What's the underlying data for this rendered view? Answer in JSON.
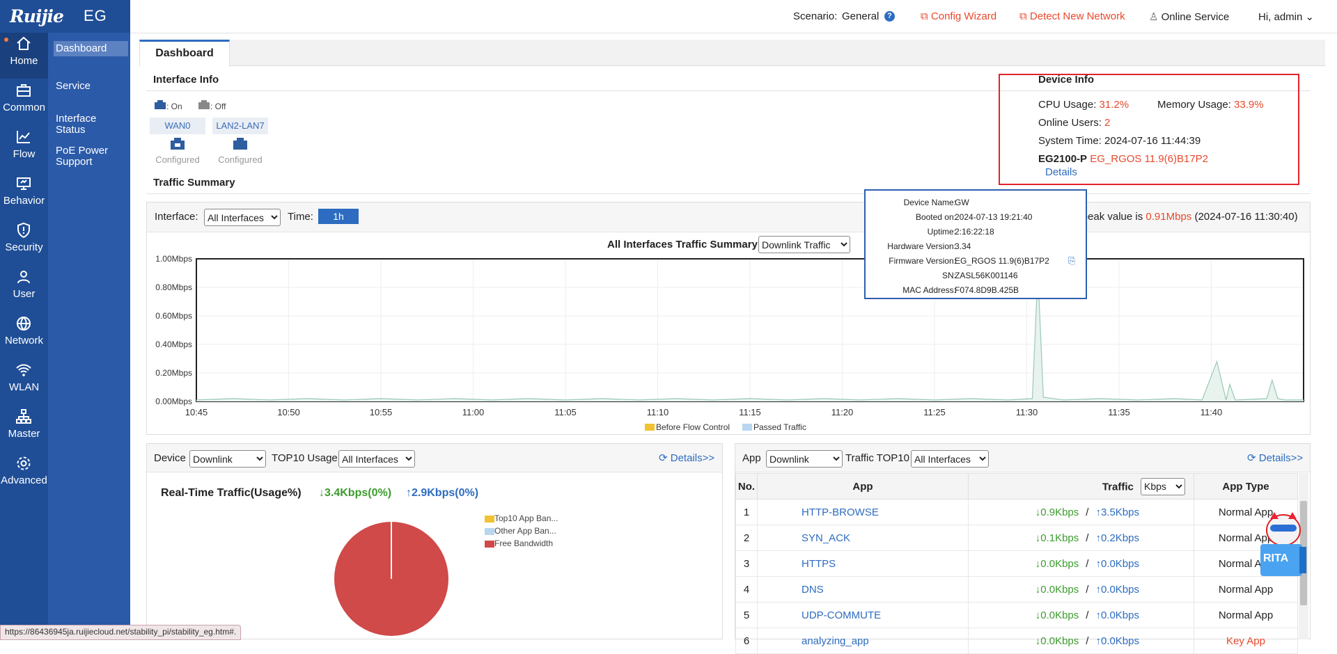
{
  "app": {
    "logo": "Ruijie",
    "product": "EG"
  },
  "rail": [
    {
      "label": "Home",
      "icon": "home-icon"
    },
    {
      "label": "Common",
      "icon": "briefcase-icon"
    },
    {
      "label": "Flow",
      "icon": "line-chart-icon"
    },
    {
      "label": "Behavior",
      "icon": "monitor-icon"
    },
    {
      "label": "Security",
      "icon": "shield-icon"
    },
    {
      "label": "User",
      "icon": "user-icon"
    },
    {
      "label": "Network",
      "icon": "globe-icon"
    },
    {
      "label": "WLAN",
      "icon": "wifi-icon"
    },
    {
      "label": "Master",
      "icon": "hierarchy-icon"
    },
    {
      "label": "Advanced",
      "icon": "gear-icon"
    }
  ],
  "subnav": [
    "Dashboard",
    "Service",
    "Interface Status",
    "PoE Power Support"
  ],
  "topbar": {
    "scenario_label": "Scenario:",
    "scenario_value": "General",
    "config_wizard": "Config Wizard",
    "detect_network": "Detect New Network",
    "online_service": "Online Service",
    "user": "Hi, admin"
  },
  "tab": "Dashboard",
  "interface_info": {
    "title": "Interface Info",
    "legend_on": ": On",
    "legend_off": ": Off",
    "ports": [
      {
        "name": "WAN0",
        "status": "Configured"
      },
      {
        "name": "LAN2-LAN7",
        "status": "Configured"
      }
    ]
  },
  "device_info": {
    "title": "Device Info",
    "cpu_label": "CPU Usage:",
    "cpu_value": "31.2%",
    "mem_label": "Memory Usage:",
    "mem_value": "33.9%",
    "users_label": "Online Users:",
    "users_value": "2",
    "time_label": "System Time:",
    "time_value": "2024-07-16 11:44:39",
    "model": "EG2100-P",
    "firmware": "EG_RGOS 11.9(6)B17P2",
    "details": "Details"
  },
  "popover": [
    {
      "k": "Device Name:",
      "v": "GW"
    },
    {
      "k": "Booted on:",
      "v": "2024-07-13 19:21:40"
    },
    {
      "k": "Uptime:",
      "v": "2:16:22:18"
    },
    {
      "k": "Hardware Version:",
      "v": "3.34"
    },
    {
      "k": "Firmware Version:",
      "v": "EG_RGOS 11.9(6)B17P2"
    },
    {
      "k": "SN:",
      "v": "ZASL56K001146"
    },
    {
      "k": "MAC Address:",
      "v": "F074.8D9B.425B"
    }
  ],
  "traffic_summary": {
    "title": "Traffic Summary",
    "interface_label": "Interface:",
    "interface_value": "All Interfaces",
    "time_label": "Time:",
    "time_value": "1h",
    "peak_prefix": "c peak value is",
    "peak_value": "0.91Mbps",
    "peak_time": "(2024-07-16 11:30:40)",
    "chart_title": "All Interfaces Traffic Summary",
    "chart_select": "Downlink Traffic"
  },
  "chart_data": {
    "type": "area",
    "title": "All Interfaces Traffic Summary",
    "y_ticks": [
      "1.00Mbps",
      "0.80Mbps",
      "0.60Mbps",
      "0.40Mbps",
      "0.20Mbps",
      "0.00Mbps"
    ],
    "ylim": [
      0,
      1.0
    ],
    "x_ticks": [
      "10:45",
      "10:50",
      "10:55",
      "11:00",
      "11:05",
      "11:10",
      "11:15",
      "11:20",
      "11:25",
      "11:30",
      "11:35",
      "11:40"
    ],
    "xlim_minutes": [
      0,
      60
    ],
    "legend": [
      "Before Flow Control",
      "Passed Traffic"
    ],
    "legend_colors": [
      "#f2c230",
      "#b8d6f0"
    ],
    "line_color": "#9bc8b8",
    "series": [
      {
        "name": "Passed Traffic",
        "points": [
          [
            0,
            0.01
          ],
          [
            2,
            0.02
          ],
          [
            4,
            0.01
          ],
          [
            6,
            0.02
          ],
          [
            8,
            0.01
          ],
          [
            10,
            0.02
          ],
          [
            12,
            0.01
          ],
          [
            14,
            0.02
          ],
          [
            16,
            0.01
          ],
          [
            18,
            0.02
          ],
          [
            20,
            0.01
          ],
          [
            22,
            0.02
          ],
          [
            24,
            0.01
          ],
          [
            26,
            0.02
          ],
          [
            28,
            0.01
          ],
          [
            30,
            0.02
          ],
          [
            32,
            0.01
          ],
          [
            34,
            0.02
          ],
          [
            36,
            0.01
          ],
          [
            38,
            0.02
          ],
          [
            40,
            0.01
          ],
          [
            42,
            0.02
          ],
          [
            44,
            0.01
          ],
          [
            45.3,
            0.02
          ],
          [
            45.6,
            0.91
          ],
          [
            45.9,
            0.03
          ],
          [
            47,
            0.01
          ],
          [
            49,
            0.02
          ],
          [
            51,
            0.01
          ],
          [
            53,
            0.02
          ],
          [
            54.5,
            0.01
          ],
          [
            55.3,
            0.28
          ],
          [
            55.8,
            0.01
          ],
          [
            56,
            0.12
          ],
          [
            56.3,
            0.01
          ],
          [
            58,
            0.02
          ],
          [
            58.3,
            0.15
          ],
          [
            58.6,
            0.02
          ],
          [
            59,
            0.01
          ],
          [
            60,
            0.01
          ]
        ]
      }
    ]
  },
  "device_top10": {
    "label": "Device",
    "direction": "Downlink",
    "usage_label": "TOP10 Usage",
    "interface": "All Interfaces",
    "details": "Details>>",
    "realtime_title": "Real-Time Traffic(Usage%)",
    "down": "↓3.4Kbps(0%)",
    "up": "↑2.9Kbps(0%)",
    "legend": [
      "Top10 App Ban...",
      "Other App Ban...",
      "Free Bandwidth"
    ],
    "legend_colors": [
      "#f2c230",
      "#b8d6f0",
      "#cf4a48"
    ],
    "pie": [
      0,
      0,
      100
    ]
  },
  "app_top10": {
    "label": "App",
    "direction": "Downlink",
    "traffic_label": "Traffic TOP10",
    "interface": "All Interfaces",
    "details": "Details>>",
    "columns": [
      "No.",
      "App",
      "Traffic",
      "App Type"
    ],
    "unit": "Kbps",
    "rows": [
      {
        "no": "1",
        "app": "HTTP-BROWSE",
        "down": "↓0.9Kbps",
        "up": "↑3.5Kbps",
        "type": "Normal App"
      },
      {
        "no": "2",
        "app": "SYN_ACK",
        "down": "↓0.1Kbps",
        "up": "↑0.2Kbps",
        "type": "Normal App"
      },
      {
        "no": "3",
        "app": "HTTPS",
        "down": "↓0.0Kbps",
        "up": "↑0.0Kbps",
        "type": "Normal App"
      },
      {
        "no": "4",
        "app": "DNS",
        "down": "↓0.0Kbps",
        "up": "↑0.0Kbps",
        "type": "Normal App"
      },
      {
        "no": "5",
        "app": "UDP-COMMUTE",
        "down": "↓0.0Kbps",
        "up": "↑0.0Kbps",
        "type": "Normal App"
      },
      {
        "no": "6",
        "app": "analyzing_app",
        "down": "↓0.0Kbps",
        "up": "↑0.0Kbps",
        "type": "Key App"
      }
    ]
  },
  "assistant": {
    "label": "RITA"
  },
  "statusbar": "https://86436945ja.ruijiecloud.net/stability_pi/stability_eg.htm#."
}
